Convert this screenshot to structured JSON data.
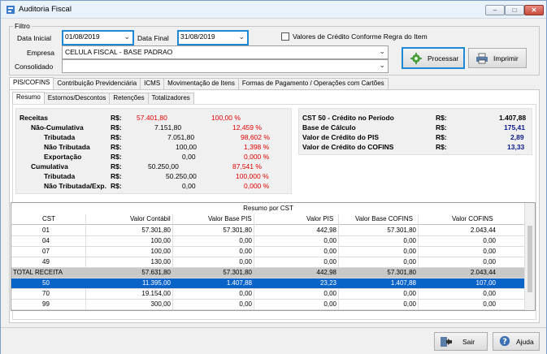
{
  "window": {
    "title": "Auditoria Fiscal",
    "min": "–",
    "max": "□",
    "close": "✕"
  },
  "filtro": {
    "legend": "Filtro",
    "data_inicial_label": "Data Inicial",
    "data_inicial": "01/08/2019",
    "data_final_label": "Data Final",
    "data_final": "31/08/2019",
    "checkbox_label": "Valores de Crédito Conforme Regra do Item",
    "empresa_label": "Empresa",
    "empresa": "CELULA FISCAL - BASE PADRAO",
    "consolidado_label": "Consolidado",
    "consolidado": "",
    "processar": "Processar",
    "imprimir": "Imprimir"
  },
  "tabs": [
    "PIS/COFINS",
    "Contribuição Previdenciária",
    "ICMS",
    "Movimentação de Itens",
    "Formas de Pagamento / Operações com Cartões"
  ],
  "subtabs": [
    "Resumo",
    "Estornos/Descontos",
    "Retenções",
    "Totalizadores"
  ],
  "receitas": [
    {
      "label": "Receitas",
      "rs": "R$:",
      "value": "57.401,80",
      "pct": "100,00 %"
    },
    {
      "label": "Não-Cumulativa",
      "rs": "R$:",
      "value": "7.151,80",
      "pct": "12,459 %"
    },
    {
      "label": "Tributada",
      "rs": "R$:",
      "value": "7.051,80",
      "pct": "98,602 %"
    },
    {
      "label": "Não Tributada",
      "rs": "R$:",
      "value": "100,00",
      "pct": "1,398 %"
    },
    {
      "label": "Exportação",
      "rs": "R$:",
      "value": "0,00",
      "pct": "0,000 %"
    },
    {
      "label": "Cumulativa",
      "rs": "R$:",
      "value": "50.250,00",
      "pct": "87,541 %"
    },
    {
      "label": "Tributada",
      "rs": "R$:",
      "value": "50.250,00",
      "pct": "100,000 %"
    },
    {
      "label": "Não Tributada/Exp.",
      "rs": "R$:",
      "value": "0,00",
      "pct": "0,000 %"
    }
  ],
  "creditos": [
    {
      "label": "CST 50 - Crédito no Período",
      "rs": "R$:",
      "value": "1.407,88"
    },
    {
      "label": "Base de Cálculo",
      "rs": "R$:",
      "value": "175,41"
    },
    {
      "label": "Valor de Crédito do PIS",
      "rs": "R$:",
      "value": "2,89"
    },
    {
      "label": "Valor de Crédito do COFINS",
      "rs": "R$:",
      "value": "13,33"
    }
  ],
  "grid": {
    "caption": "Resumo por CST",
    "headers": [
      "CST",
      "Valor Contábil",
      "Valor Base PIS",
      "Valor PIS",
      "Valor Base COFINS",
      "Valor COFINS"
    ],
    "rows": [
      [
        "01",
        "57.301,80",
        "57.301,80",
        "442,98",
        "57.301,80",
        "2.043,44"
      ],
      [
        "04",
        "100,00",
        "0,00",
        "0,00",
        "0,00",
        "0,00"
      ],
      [
        "07",
        "100,00",
        "0,00",
        "0,00",
        "0,00",
        "0,00"
      ],
      [
        "49",
        "130,00",
        "0,00",
        "0,00",
        "0,00",
        "0,00"
      ],
      [
        "TOTAL RECEITA",
        "57.631,80",
        "57.301,80",
        "442,98",
        "57.301,80",
        "2.043,44"
      ],
      [
        "50",
        "11.395,00",
        "1.407,88",
        "23,23",
        "1.407,88",
        "107,00"
      ],
      [
        "70",
        "19.154,00",
        "0,00",
        "0,00",
        "0,00",
        "0,00"
      ],
      [
        "99",
        "300,00",
        "0,00",
        "0,00",
        "0,00",
        "0,00"
      ]
    ]
  },
  "footer": {
    "sair": "Sair",
    "ajuda": "Ajuda"
  }
}
